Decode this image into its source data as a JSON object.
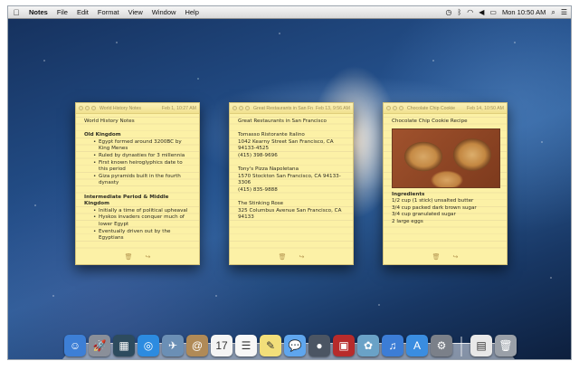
{
  "menubar": {
    "app_name": "Notes",
    "menus": [
      "File",
      "Edit",
      "Format",
      "View",
      "Window",
      "Help"
    ],
    "clock": "Mon 10:50 AM"
  },
  "notes": [
    {
      "window_title": "World History Notes",
      "date": "Feb 1, 10:27 AM",
      "lines": [
        {
          "type": "text",
          "text": "World History Notes"
        },
        {
          "type": "gap"
        },
        {
          "type": "heading",
          "text": "Old Kingdom"
        },
        {
          "type": "bullet",
          "text": "Egypt formed around 3200BC by King Menes"
        },
        {
          "type": "bullet",
          "text": "Ruled by dynasties for 3 millennia"
        },
        {
          "type": "bullet",
          "text": "First known heiroglyphics date to this period"
        },
        {
          "type": "bullet",
          "text": "Giza pyramids built in the fourth dynasty"
        },
        {
          "type": "gap"
        },
        {
          "type": "heading",
          "text": "Intermediate Period & Middle Kingdom"
        },
        {
          "type": "bullet",
          "text": "Initially a time of political upheaval"
        },
        {
          "type": "bullet",
          "text": "Hyskos invaders conquer much of lower Egypt"
        },
        {
          "type": "bullet",
          "text": "Eventually driven out by the Egyptians"
        }
      ]
    },
    {
      "window_title": "Great Restaurants in San Fra...",
      "date": "Feb 13, 9:56 AM",
      "lines": [
        {
          "type": "text",
          "text": "Great Restaurants in San Francisco"
        },
        {
          "type": "gap"
        },
        {
          "type": "text",
          "text": "Tomasso Ristorante Italino"
        },
        {
          "type": "text",
          "text": "1042 Kearny Street San Francisco, CA 94133-4525"
        },
        {
          "type": "text",
          "text": "(415) 398-9696"
        },
        {
          "type": "gap"
        },
        {
          "type": "text",
          "text": "Tony's Pizza Napoletana"
        },
        {
          "type": "text",
          "text": "1570 Stockton San Francisco, CA 94133-3306"
        },
        {
          "type": "text",
          "text": "(415) 835-9888"
        },
        {
          "type": "gap"
        },
        {
          "type": "text",
          "text": "The Stinking Rose"
        },
        {
          "type": "text",
          "text": "325 Columbus Avenue San Francisco, CA 94133"
        }
      ]
    },
    {
      "window_title": "Chocolate Chip Cookie",
      "date": "Feb 14, 10:50 AM",
      "lines_before_image": [
        {
          "type": "text",
          "text": "Chocolate Chip Cookie Recipe"
        }
      ],
      "lines": [
        {
          "type": "heading",
          "text": "Ingredients"
        },
        {
          "type": "text",
          "text": "1/2 cup (1 stick) unsalted butter"
        },
        {
          "type": "text",
          "text": "3/4 cup packed dark brown sugar"
        },
        {
          "type": "text",
          "text": "3/4 cup granulated sugar"
        },
        {
          "type": "text",
          "text": "2 large eggs"
        }
      ]
    }
  ],
  "dock": [
    {
      "name": "finder",
      "glyph": "☺",
      "color": "#3d7fd6"
    },
    {
      "name": "launchpad",
      "glyph": "🚀",
      "color": "#8a8f99"
    },
    {
      "name": "mission-control",
      "glyph": "▦",
      "color": "#2d4b5e"
    },
    {
      "name": "safari",
      "glyph": "◎",
      "color": "#2c8be0"
    },
    {
      "name": "mail",
      "glyph": "✈",
      "color": "#6b8fb5"
    },
    {
      "name": "contacts",
      "glyph": "@",
      "color": "#b08a57"
    },
    {
      "name": "calendar",
      "glyph": "17",
      "color": "#f4f4f4"
    },
    {
      "name": "reminders",
      "glyph": "☰",
      "color": "#f7f7f7"
    },
    {
      "name": "notes",
      "glyph": "✎",
      "color": "#f2df7a"
    },
    {
      "name": "messages",
      "glyph": "💬",
      "color": "#5fa6ee"
    },
    {
      "name": "facetime",
      "glyph": "●",
      "color": "#4b5563"
    },
    {
      "name": "photo-booth",
      "glyph": "▣",
      "color": "#b72b2b"
    },
    {
      "name": "iphoto",
      "glyph": "✿",
      "color": "#6aa2c7"
    },
    {
      "name": "itunes",
      "glyph": "♫",
      "color": "#3c7dd6"
    },
    {
      "name": "app-store",
      "glyph": "A",
      "color": "#3a8de0"
    },
    {
      "name": "system-preferences",
      "glyph": "⚙",
      "color": "#7b8089"
    },
    {
      "name": "document",
      "glyph": "▤",
      "color": "#e8e8e8"
    },
    {
      "name": "trash",
      "glyph": "🗑",
      "color": "#9aa0a8"
    }
  ]
}
